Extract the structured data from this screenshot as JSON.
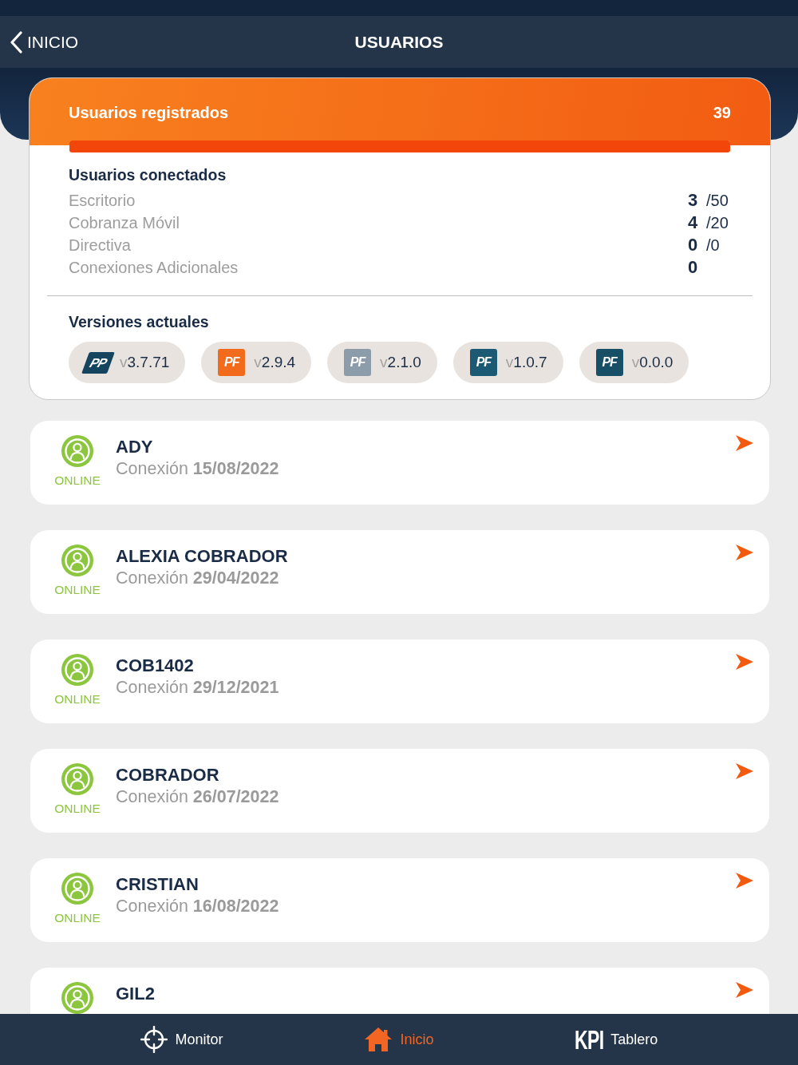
{
  "header": {
    "back": "INICIO",
    "title": "USUARIOS"
  },
  "registered": {
    "label": "Usuarios registrados",
    "count": "39",
    "level": 1
  },
  "connected": {
    "title": "Usuarios conectados",
    "rows": [
      {
        "label": "Escritorio",
        "count": "3",
        "limit": "/50"
      },
      {
        "label": "Cobranza Móvil",
        "count": "4",
        "limit": "/20"
      },
      {
        "label": "Directiva",
        "count": "0",
        "limit": "/0"
      },
      {
        "label": "Conexiones Adicionales",
        "count": "0"
      }
    ]
  },
  "versions": {
    "title": "Versiones actuales",
    "items": [
      {
        "kind": "slanted",
        "logo": "PP",
        "color": "#14445e",
        "prefix": "v",
        "number": "3.7.71"
      },
      {
        "kind": "square",
        "logo": "PF",
        "color": "#f26a1b",
        "prefix": "v",
        "number": "2.9.4"
      },
      {
        "kind": "square",
        "logo": "PF",
        "color": "#8d9cab",
        "prefix": "v",
        "number": "2.1.0"
      },
      {
        "kind": "square",
        "logo": "PF",
        "color": "#1b5a72",
        "prefix": "v",
        "number": "1.0.7"
      },
      {
        "kind": "square",
        "logo": "PF",
        "color": "#174f66",
        "prefix": "v",
        "number": "0.0.0"
      }
    ]
  },
  "users": [
    {
      "name": "ADY",
      "online": true,
      "status": "ONLINE",
      "connection": "Conexión **15/08/2022**"
    },
    {
      "name": "ALEXIA COBRADOR",
      "online": true,
      "status": "ONLINE",
      "connection": "Conexión **29/04/2022**"
    },
    {
      "name": "COB1402",
      "online": true,
      "status": "ONLINE",
      "connection": "Conexión **29/12/2021**"
    },
    {
      "name": "COBRADOR",
      "online": true,
      "status": "ONLINE",
      "connection": "Conexión **26/07/2022**"
    },
    {
      "name": "CRISTIAN",
      "online": true,
      "status": "ONLINE",
      "connection": "Conexión **16/08/2022**"
    },
    {
      "name": "GIL2",
      "online": true
    }
  ],
  "tabs": [
    {
      "kind": "monitor",
      "label": "Monitor",
      "selected": false
    },
    {
      "kind": "home",
      "label": "Inicio",
      "selected": true
    },
    {
      "kind": "kpi",
      "icon_text": "KPI",
      "label": "Tablero",
      "selected": false
    }
  ]
}
